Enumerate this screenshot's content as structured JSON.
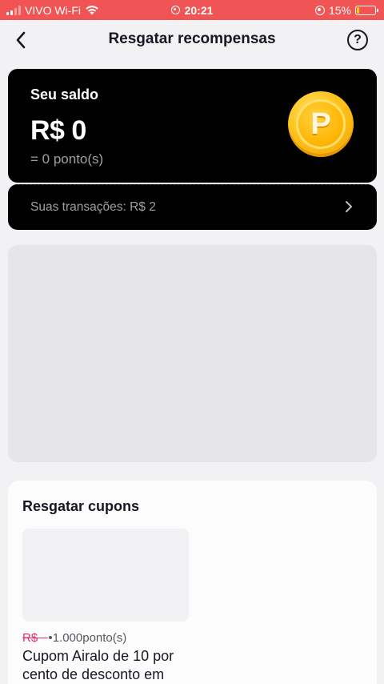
{
  "status_bar": {
    "carrier": "VIVO Wi-Fi",
    "time": "20:21",
    "battery_percent": "15%",
    "battery_level": 0.15,
    "background_color": "#f05454"
  },
  "header": {
    "title": "Resgatar recompensas",
    "back_icon": "back-arrow-icon",
    "help_icon": "help-circle-icon",
    "help_glyph": "?"
  },
  "balance": {
    "label": "Seu saldo",
    "amount": "R$ 0",
    "points": "= 0 ponto(s)",
    "coin_letter": "P",
    "card_color": "#000000",
    "coin_color": "#ffc21a"
  },
  "transactions": {
    "label": "Suas transações: R$ 2",
    "chevron_icon": "chevron-right-icon"
  },
  "coupons": {
    "title": "Resgatar cupons",
    "items": [
      {
        "old_price": "R$",
        "points_price": "1.000ponto(s)",
        "name": "Cupom Airalo de 10 por cento de desconto em"
      }
    ]
  }
}
